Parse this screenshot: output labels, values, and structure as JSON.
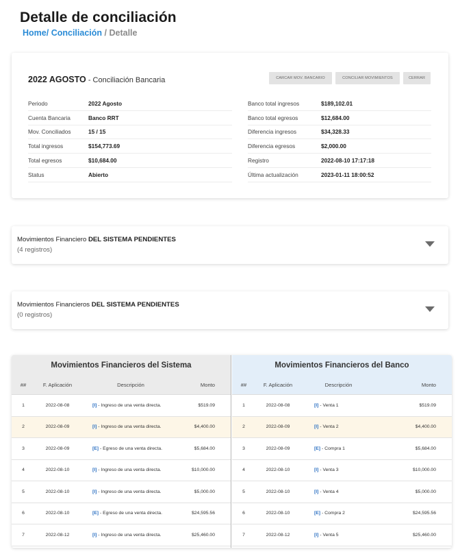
{
  "page": {
    "title": "Detalle de conciliación",
    "breadcrumb": {
      "home": "Home",
      "sep1": "/",
      "conciliacion": "Conciliación",
      "sep2": "/",
      "current": "Detalle"
    }
  },
  "summary": {
    "period_strong": "2022  AGOSTO",
    "subtitle": " - Conciliación Bancaria",
    "buttons": {
      "cargar": "CARCAR MOV. BANCARIO",
      "conciliar": "CONCILIAR MOVIMIENTOS",
      "cerrar": "CERRAR"
    },
    "left": [
      {
        "label": "Periodo",
        "value": "2022 Agosto"
      },
      {
        "label": "Cuenta Bancaria",
        "value": "Banco RRT"
      },
      {
        "label": "Mov. Conciliados",
        "value": "15 / 15"
      },
      {
        "label": "Total ingresos",
        "value": "$154,773.69"
      },
      {
        "label": "Total egresos",
        "value": "$10,684.00"
      },
      {
        "label": "Status",
        "value": "Abierto"
      }
    ],
    "right": [
      {
        "label": "Banco total ingresos",
        "value": "$189,102.01"
      },
      {
        "label": "Banco total egresos",
        "value": "$12,684.00"
      },
      {
        "label": "Diferencia ingresos",
        "value": "$34,328.33"
      },
      {
        "label": "Diferencia egresos",
        "value": "$2,000.00"
      },
      {
        "label": "Registro",
        "value": "2022-08-10 17:17:18"
      },
      {
        "label": "Última actualización",
        "value": "2023-01-11 18:00:52"
      }
    ]
  },
  "accordions": [
    {
      "title_prefix": "Movimientos Financiero ",
      "title_strong": "DEL SISTEMA PENDIENTES",
      "count": "(4 registros)"
    },
    {
      "title_prefix": "Movimientos Financieros ",
      "title_strong": "DEL SISTEMA PENDIENTES",
      "count": "(0 registros)"
    }
  ],
  "system_table": {
    "title": "Movimientos Financieros del Sistema",
    "headers": {
      "num": "##",
      "date": "F. Aplicación",
      "desc": "Descripción",
      "amount": "Monto"
    },
    "rows": [
      {
        "num": "1",
        "date": "2022-08-08",
        "tag": "[I]",
        "desc": " - Ingreso de una venta directa.",
        "amount": "$519.09"
      },
      {
        "num": "2",
        "date": "2022-08-09",
        "tag": "[I]",
        "desc": "   - Ingreso de una venta directa.",
        "amount": "$4,400.00"
      },
      {
        "num": "3",
        "date": "2022-08-09",
        "tag": "[E]",
        "desc": " - Egreso de una venta directa.",
        "amount": "$5,684.00"
      },
      {
        "num": "4",
        "date": "2022-08-10",
        "tag": "[I]",
        "desc": " - Ingreso de una venta directa.",
        "amount": "$10,000.00"
      },
      {
        "num": "5",
        "date": "2022-08-10",
        "tag": "[I]",
        "desc": " - Ingreso de una venta directa.",
        "amount": "$5,000.00"
      },
      {
        "num": "6",
        "date": "2022-08-10",
        "tag": "[E]",
        "desc": " - Egreso de una venta directa.",
        "amount": "$24,595.56"
      },
      {
        "num": "7",
        "date": "2022-08-12",
        "tag": "[I]",
        "desc": " - Ingreso de una venta directa.",
        "amount": "$25,460.00"
      }
    ]
  },
  "bank_table": {
    "title": "Movimientos Financieros del Banco",
    "headers": {
      "num": "##",
      "date": "F. Aplicación",
      "desc": "Descripción",
      "amount": "Monto"
    },
    "rows": [
      {
        "num": "1",
        "date": "2022-08-08",
        "tag": "[I]",
        "desc": " - Venta 1",
        "amount": "$519.09"
      },
      {
        "num": "2",
        "date": "2022-08-09",
        "tag": "[I]",
        "desc": " - Venta 2",
        "amount": "$4,400.00"
      },
      {
        "num": "3",
        "date": "2022-08-09",
        "tag": "[E]",
        "desc": " - Compra 1",
        "amount": "$5,684.00"
      },
      {
        "num": "4",
        "date": "2022-08-10",
        "tag": "[I]",
        "desc": " - Venta 3",
        "amount": "$10,000.00"
      },
      {
        "num": "5",
        "date": "2022-08-10",
        "tag": "[I]",
        "desc": " - Venta 4",
        "amount": "$5,000.00"
      },
      {
        "num": "6",
        "date": "2022-08-10",
        "tag": "[E]",
        "desc": " - Compra 2",
        "amount": "$24,595.56"
      },
      {
        "num": "7",
        "date": "2022-08-12",
        "tag": "[I]",
        "desc": " - Venta 5",
        "amount": "$25,460.00"
      }
    ]
  },
  "highlighted_row": 2
}
